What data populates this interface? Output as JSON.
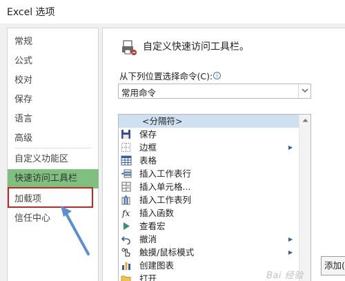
{
  "window": {
    "title": "Excel 选项"
  },
  "nav": {
    "items": [
      {
        "label": "常规"
      },
      {
        "label": "公式"
      },
      {
        "label": "校对"
      },
      {
        "label": "保存"
      },
      {
        "label": "语言"
      },
      {
        "label": "高级"
      },
      {
        "label": "自定义功能区"
      },
      {
        "label": "快速访问工具栏"
      },
      {
        "label": "加载项"
      },
      {
        "label": "信任中心"
      }
    ],
    "selected": "快速访问工具栏"
  },
  "main": {
    "header": "自定义快速访问工具栏。",
    "choose_label": "从下列位置选择命令(C):",
    "info_icon_glyph": "i",
    "choose_value": "常用命令",
    "commands": [
      {
        "label": "<分隔符>",
        "icon": "none",
        "selected": true
      },
      {
        "label": "保存",
        "icon": "save-icon"
      },
      {
        "label": "边框",
        "icon": "border-icon",
        "submenu": true
      },
      {
        "label": "表格",
        "icon": "table-icon"
      },
      {
        "label": "插入工作表行",
        "icon": "insert-row-icon"
      },
      {
        "label": "插入单元格...",
        "icon": "insert-cells-icon"
      },
      {
        "label": "插入工作表列",
        "icon": "insert-column-icon"
      },
      {
        "label": "插入函数",
        "icon": "function-icon"
      },
      {
        "label": "查看宏",
        "icon": "macro-icon"
      },
      {
        "label": "撤消",
        "icon": "undo-icon",
        "submenu": true
      },
      {
        "label": "触摸/鼠标模式",
        "icon": "touch-mouse-icon",
        "submenu": true
      },
      {
        "label": "创建图表",
        "icon": "chart-icon"
      },
      {
        "label": "打开",
        "icon": "open-folder-icon"
      }
    ],
    "submenu_glyph": "▶",
    "add_button": "添加(A)"
  },
  "watermark": "Bai 经验",
  "colors": {
    "nav_selected": "#7fbf7f",
    "highlight_box": "#d02020",
    "arrow": "#5b8fd0",
    "list_selected": "#cfe0f1"
  }
}
